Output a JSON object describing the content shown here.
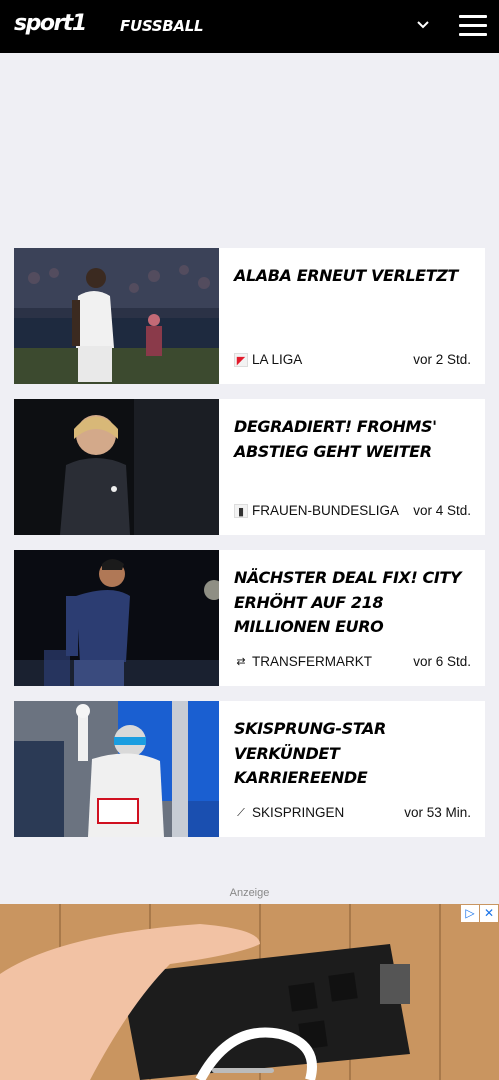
{
  "header": {
    "logo": "sport1",
    "section": "FUSSBALL"
  },
  "articles": [
    {
      "headline": "ALABA ERNEUT VERLETZT",
      "category": "LA LIGA",
      "category_icon": "la-liga-icon",
      "time": "vor 2 Std."
    },
    {
      "headline": "DEGRADIERT! FROHMS' ABSTIEG GEHT WEITER",
      "category": "FRAUEN-BUNDESLIGA",
      "category_icon": "frauen-bundesliga-icon",
      "time": "vor 4 Std."
    },
    {
      "headline": "NÄCHSTER DEAL FIX! CITY ERHÖHT AUF 218 MILLIONEN EURO",
      "category": "TRANSFERMARKT",
      "category_icon": "transfer-arrows-icon",
      "time": "vor 6 Std."
    },
    {
      "headline": "SKISPRUNG-STAR VERKÜNDET KARRIEREENDE",
      "category": "SKISPRINGEN",
      "category_icon": "ski-jump-icon",
      "time": "vor 53 Min."
    }
  ],
  "ad": {
    "label": "Anzeige",
    "adchoices_icon": "adchoices-icon",
    "close_icon": "close-icon"
  },
  "colors": {
    "header_bg": "#000000",
    "page_bg": "#efeff4",
    "card_bg": "#ffffff"
  }
}
